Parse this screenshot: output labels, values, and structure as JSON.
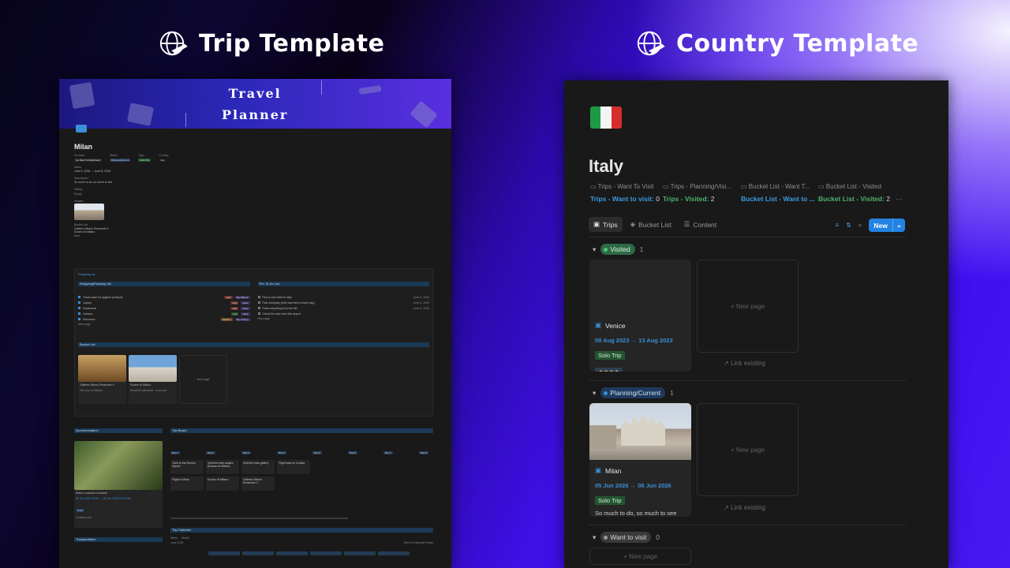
{
  "headers": {
    "left": "Trip Template",
    "right": "Country Template"
  },
  "left": {
    "banner_title": [
      "Travel",
      "Planner"
    ],
    "title": "Milan",
    "props": {
      "row_labels": [
        "Go back",
        "Status",
        "Type",
        "Country"
      ],
      "row_values": [
        "Go Back To Dashboard",
        "Planning/Current",
        "Solo Trip",
        "Italy"
      ],
      "dates_label": "Dates",
      "dates": "June 5, 2026 → June 8, 2026",
      "desc_label": "Description",
      "desc": "So much to do, so much to see",
      "rating_label": "Rating",
      "rating": "Empty",
      "images_label": "Images",
      "bucket_label": "Bucket List",
      "bucket": [
        "Galleria Vittorio Emanuele II",
        "Duomo di Milano"
      ],
      "new": "New"
    },
    "prep": "Prepping up",
    "shopping": "Shopping/Packing List",
    "shopping_items": [
      {
        "n": "Travel case for hygiene products",
        "p": "High",
        "c": "Buy Before"
      },
      {
        "n": "Laptop",
        "p": "High",
        "c": "Have"
      },
      {
        "n": "Underwear",
        "p": "High",
        "c": "Have"
      },
      {
        "n": "Camera",
        "p": "Low",
        "c": "Have"
      },
      {
        "n": "Souvenirs",
        "p": "Medium",
        "c": "Buy During"
      }
    ],
    "todo": "Pre-To-Do List",
    "todo_items": [
      {
        "n": "Find a nice hotel to stay",
        "d": "June 5, 2026"
      },
      {
        "n": "Plan everyday (brief overview of each day)",
        "d": "June 5, 2026"
      },
      {
        "n": "Pack everything from the list",
        "d": "June 6, 2026"
      },
      {
        "n": "Check the train from the airport",
        "d": ""
      }
    ],
    "new_page": "New page",
    "bucket": "Bucket List",
    "bucket_cards": [
      {
        "n": "Galleria Vittorio Emanuele II",
        "s": "Italy",
        "d": "The Icon of Milano"
      },
      {
        "n": "Duomo di Milano",
        "s": "Italy",
        "d": "Beautiful cathedral - must see"
      }
    ],
    "accommodation": "Accommodation",
    "acc": {
      "n": "Antica Locanda Leonardo",
      "d": "05 Jun 2026 13:00 → 08 Jun 2026 10:00 AM",
      "tag": "Hotel",
      "site": "booking.com"
    },
    "transport": "Transportation",
    "trip_board": "Trip Board",
    "days": [
      "Day 1",
      "Day 2",
      "Day 3",
      "Day 4",
      "Day 5",
      "Day 6",
      "Day 7",
      "Day 8"
    ],
    "board_items": [
      [
        "Train to the Duomo Airport",
        "Flight to Milan"
      ],
      [
        "Visit the main square (Duomo di Milano)",
        "Duomo di Milano"
      ],
      [
        "Visit the main gallery",
        "Galleria Vittorio Emanuele II"
      ],
      [
        "Flight back to Croatia"
      ]
    ],
    "calendar": "Trip Calendar",
    "cal_views": [
      "Week",
      "Month"
    ],
    "cal_month": "June 2026",
    "cal_btns": [
      "Open in Calendar",
      "Today"
    ]
  },
  "right": {
    "flag": "italy-flag",
    "title": "Italy",
    "props": [
      {
        "label": "Trips - Want To Visit",
        "value": "Trips - Want to visit:",
        "num": "0",
        "color": "blue"
      },
      {
        "label": "Trips - Planning/Visi...",
        "value": "Trips - Visited:",
        "num": "2",
        "color": "green"
      },
      {
        "label": "Bucket List - Want T...",
        "value": "Bucket List - Want to ...",
        "num": "",
        "color": "blue"
      },
      {
        "label": "Bucket List - Visited",
        "value": "Bucket List - Visited:",
        "num": "2",
        "color": "green"
      }
    ],
    "more": "···",
    "tabs": [
      "Trips",
      "Bucket List",
      "Content"
    ],
    "new_btn": "New",
    "groups": [
      {
        "label": "Visited",
        "count": "1",
        "color": "#2d6b45",
        "dot": "#4ec77a"
      },
      {
        "label": "Planning/Current",
        "count": "1",
        "color": "#1f3a5c",
        "dot": "#3b8fd6"
      },
      {
        "label": "Want to visit",
        "count": "0",
        "color": "#3a3a3a",
        "dot": "#9a9a9a"
      }
    ],
    "cards": [
      {
        "name": "Venice",
        "dates": "09 Aug 2023 → 13 Aug 2023",
        "tag": "Solo Trip",
        "rating": "★★★★"
      },
      {
        "name": "Milan",
        "dates": "05 Jun 2026 → 08 Jun 2026",
        "tag": "Solo Trip",
        "desc": "So much to do, so much to see"
      }
    ],
    "new_page": "New page",
    "link_existing": "Link existing"
  }
}
